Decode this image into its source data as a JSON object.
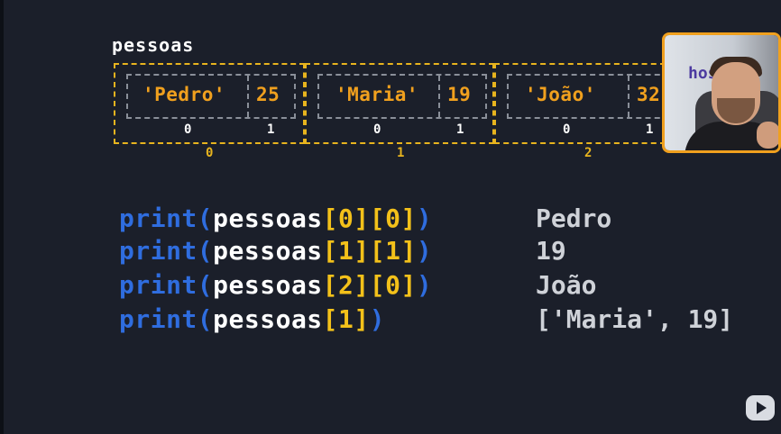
{
  "list_label": "pessoas",
  "boxes": [
    {
      "outer_index": "0",
      "item0": "'Pedro'",
      "item1": "25",
      "idx0": "0",
      "idx1": "1"
    },
    {
      "outer_index": "1",
      "item0": "'Maria'",
      "item1": "19",
      "idx0": "0",
      "idx1": "1"
    },
    {
      "outer_index": "2",
      "item0": "'João'",
      "item1": "32",
      "idx0": "0",
      "idx1": "1"
    }
  ],
  "code_lines": [
    {
      "kw": "print(",
      "var": "pessoas",
      "idx": "[0][0]",
      "close": ")",
      "output": "Pedro"
    },
    {
      "kw": "print(",
      "var": "pessoas",
      "idx": "[1][1]",
      "close": ")",
      "output": "19"
    },
    {
      "kw": "print(",
      "var": "pessoas",
      "idx": "[2][0]",
      "close": ")",
      "output": "João"
    },
    {
      "kw": "print(",
      "var": "pessoas",
      "idx": "[1]",
      "close": ")",
      "output": "['Maria', 19]"
    }
  ],
  "webcam": {
    "logo_text": "hos"
  },
  "colors": {
    "background": "#1b1f2a",
    "keyword": "#2f6ddf",
    "bracket": "#f3c11a",
    "string": "#f0a01e",
    "outer_border": "#e8b41e",
    "inner_border": "#8a8f99"
  },
  "icons": {
    "corner": "play-logo-icon"
  }
}
